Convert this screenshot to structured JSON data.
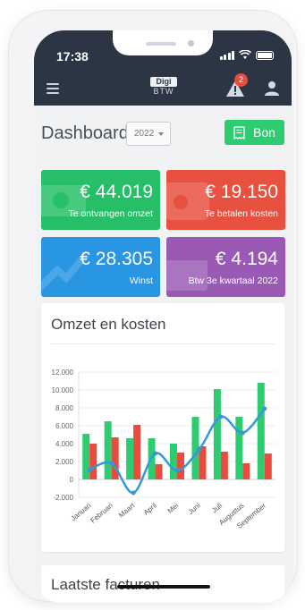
{
  "status_bar": {
    "time": "17:38"
  },
  "navbar": {
    "logo_top": "Digi",
    "logo_bottom": "BTW",
    "notification_count": "2",
    "icons": [
      "hamburger-icon",
      "alert-icon",
      "user-icon"
    ]
  },
  "header": {
    "title": "Dashboard",
    "year": "2022",
    "bon_label": "Bon"
  },
  "cards": [
    {
      "amount": "€ 44.019",
      "label": "Te ontvangen omzet",
      "color": "#26bf68"
    },
    {
      "amount": "€ 19.150",
      "label": "Te betalen kosten",
      "color": "#e8503f"
    },
    {
      "amount": "€ 28.305",
      "label": "Winst",
      "color": "#2896e3"
    },
    {
      "amount": "€ 4.194",
      "label": "Btw 3e kwartaal 2022",
      "color": "#9b59b6"
    }
  ],
  "chart_panel": {
    "title": "Omzet en kosten"
  },
  "chart_data": {
    "type": "bar",
    "categories": [
      "Januari",
      "Februari",
      "Maart",
      "April",
      "Mei",
      "Juni",
      "Juli",
      "Augustus",
      "September"
    ],
    "series": [
      {
        "type": "bar",
        "color": "#2ecc71",
        "values": [
          5100,
          6500,
          4600,
          4600,
          4000,
          7000,
          10100,
          7000,
          10800
        ]
      },
      {
        "type": "bar",
        "color": "#e74c3c",
        "values": [
          4000,
          4700,
          6100,
          1700,
          3000,
          3700,
          3100,
          1800,
          2900
        ]
      },
      {
        "type": "line",
        "color": "#3498db",
        "values": [
          1100,
          1800,
          -1500,
          2900,
          1000,
          3300,
          7000,
          5200,
          7900
        ]
      }
    ],
    "y_ticks": [
      "12.000",
      "10.000",
      "8.000",
      "6.000",
      "4.000",
      "2.000",
      "0",
      "-2.000"
    ],
    "ylim": [
      -2000,
      12000
    ],
    "grid": true
  },
  "second_panel": {
    "title": "Laatste facturen"
  }
}
